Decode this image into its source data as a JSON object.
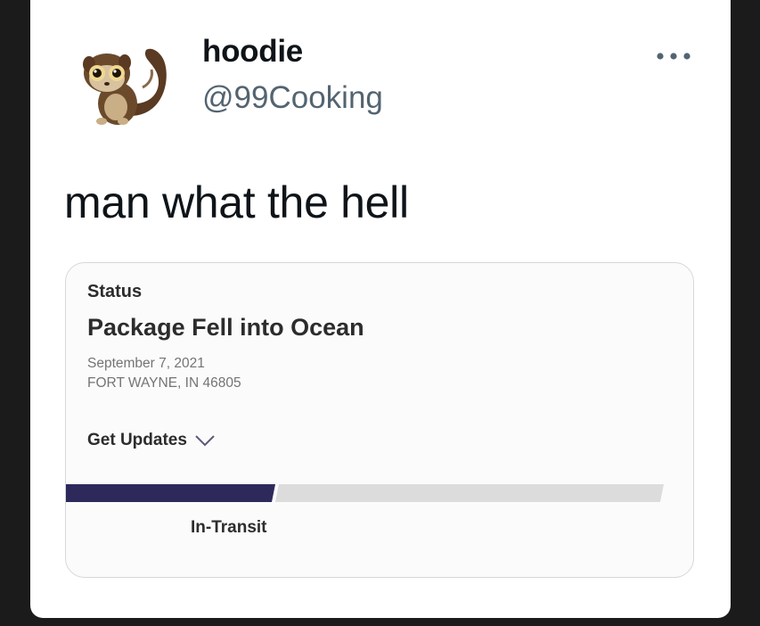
{
  "tweet": {
    "display_name": "hoodie",
    "handle": "@99Cooking",
    "text": "man what the hell",
    "more_icon": "more-horizontal-icon"
  },
  "tracking": {
    "status_label": "Status",
    "status_title": "Package Fell into Ocean",
    "date": "September 7, 2021",
    "location": "FORT WAYNE, IN 46805",
    "get_updates_label": "Get Updates",
    "get_updates_icon": "chevron-down-icon",
    "progress_label": "In-Transit",
    "progress_fraction": 0.35,
    "progress_color": "#2d2a5b",
    "track_color": "#dcdcdc"
  }
}
